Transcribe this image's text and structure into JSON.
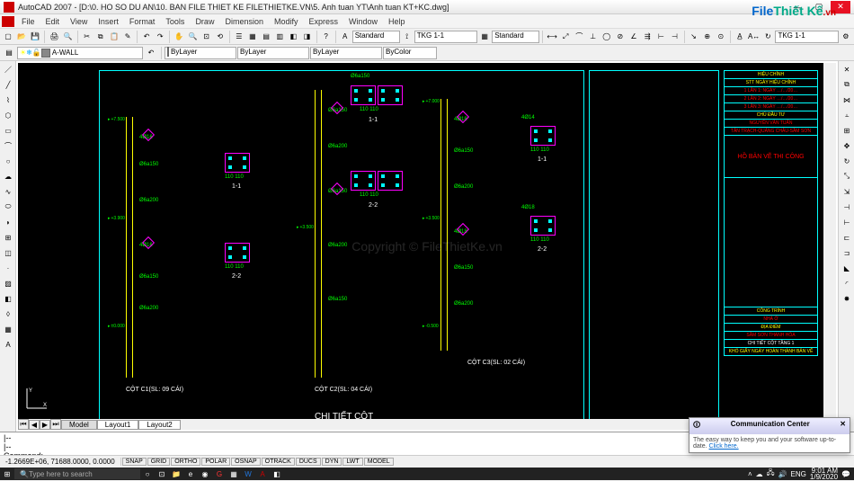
{
  "app": {
    "title": "AutoCAD 2007 - [D:\\0. HO SO DU AN\\10. BAN FILE THIET KE FILETHIETKE.VN\\5. Anh tuan YT\\Anh tuan KT+KC.dwg]"
  },
  "menu": [
    "File",
    "Edit",
    "View",
    "Insert",
    "Format",
    "Tools",
    "Draw",
    "Dimension",
    "Modify",
    "Express",
    "Window",
    "Help"
  ],
  "layer": {
    "current": "A-WALL"
  },
  "style": {
    "text": "Standard",
    "dim": "TKG 1-1",
    "table": "Standard",
    "dim2": "TKG 1-1"
  },
  "props": {
    "color": "ByLayer",
    "ltype": "ByLayer",
    "lweight": "ByLayer",
    "plot": "ByColor"
  },
  "tabs": {
    "items": [
      "Model",
      "Layout1",
      "Layout2"
    ],
    "active": 0
  },
  "cmd": {
    "line1": "|--",
    "line2": "|--",
    "prompt": "Command:"
  },
  "status": {
    "coords": "-1.2669E+06, 71688.0000, 0.0000",
    "toggles": [
      "SNAP",
      "GRID",
      "ORTHO",
      "POLAR",
      "OSNAP",
      "OTRACK",
      "DUCS",
      "DYN",
      "LWT",
      "MODEL"
    ]
  },
  "taskbar": {
    "search_placeholder": "Type here to search",
    "time": "9:01 AM",
    "date": "1/9/2020",
    "lang": "ENG"
  },
  "popup": {
    "title": "Communication Center",
    "body": "The easy way to keep you and your software up-to-date.",
    "link": "Click here."
  },
  "logo": {
    "p1": "File",
    "p2": "Thiết Kế",
    "p3": ".vn"
  },
  "drawing": {
    "main_title": "CHI TIẾT CỘT",
    "col1_label": "CỘT C1(SL: 09 CÁI)",
    "col2_label": "CỘT C2(SL: 04 CÁI)",
    "col3_label": "CỘT C3(SL: 02 CÁI)",
    "sect_labels": {
      "s11": "1-1",
      "s22": "2-2"
    },
    "dim_110": "110 110",
    "dim_110b": "110",
    "rebar": {
      "a": "4Ø16",
      "b": "Ø6a150",
      "c": "Ø6a200",
      "d": "4Ø18",
      "e": "4Ø14"
    },
    "levels": [
      "+7.500",
      "+3.900",
      "±0.000",
      "+7.000",
      "+3.500",
      "-0.500"
    ],
    "titleblock": {
      "head": "HIỆU CHỈNH",
      "cols": "STT    NGÀY HIỆU CHỈNH",
      "r1": "1  LẦN 1: NGÀY …/…/20…",
      "r2": "2  LẦN 2: NGÀY …/…/20…",
      "r3": "3  LẦN 3: NGÀY …/…/20…",
      "owner_h": "CHỦ ĐẦU TƯ",
      "owner": "NGUYỄN VĂN TUẤN",
      "addr": "TÂN TRẠCH-QUẢNG CHÂU-SẦM SƠN",
      "stamp": "HỒ BẢN VẼ THI CÔNG",
      "proj_h": "CÔNG TRÌNH",
      "proj": "NHÀ Ở",
      "loc_h": "ĐỊA ĐIỂM",
      "loc": "SẦM SƠN THANH HÓA",
      "sheet": "CHI TIẾT CỘT TẦNG 1",
      "foot": "KHỔ GIẤY    NGÀY HOÀN THÀNH BẢN VẼ"
    }
  },
  "watermark": "Copyright © FileThietKe.vn"
}
